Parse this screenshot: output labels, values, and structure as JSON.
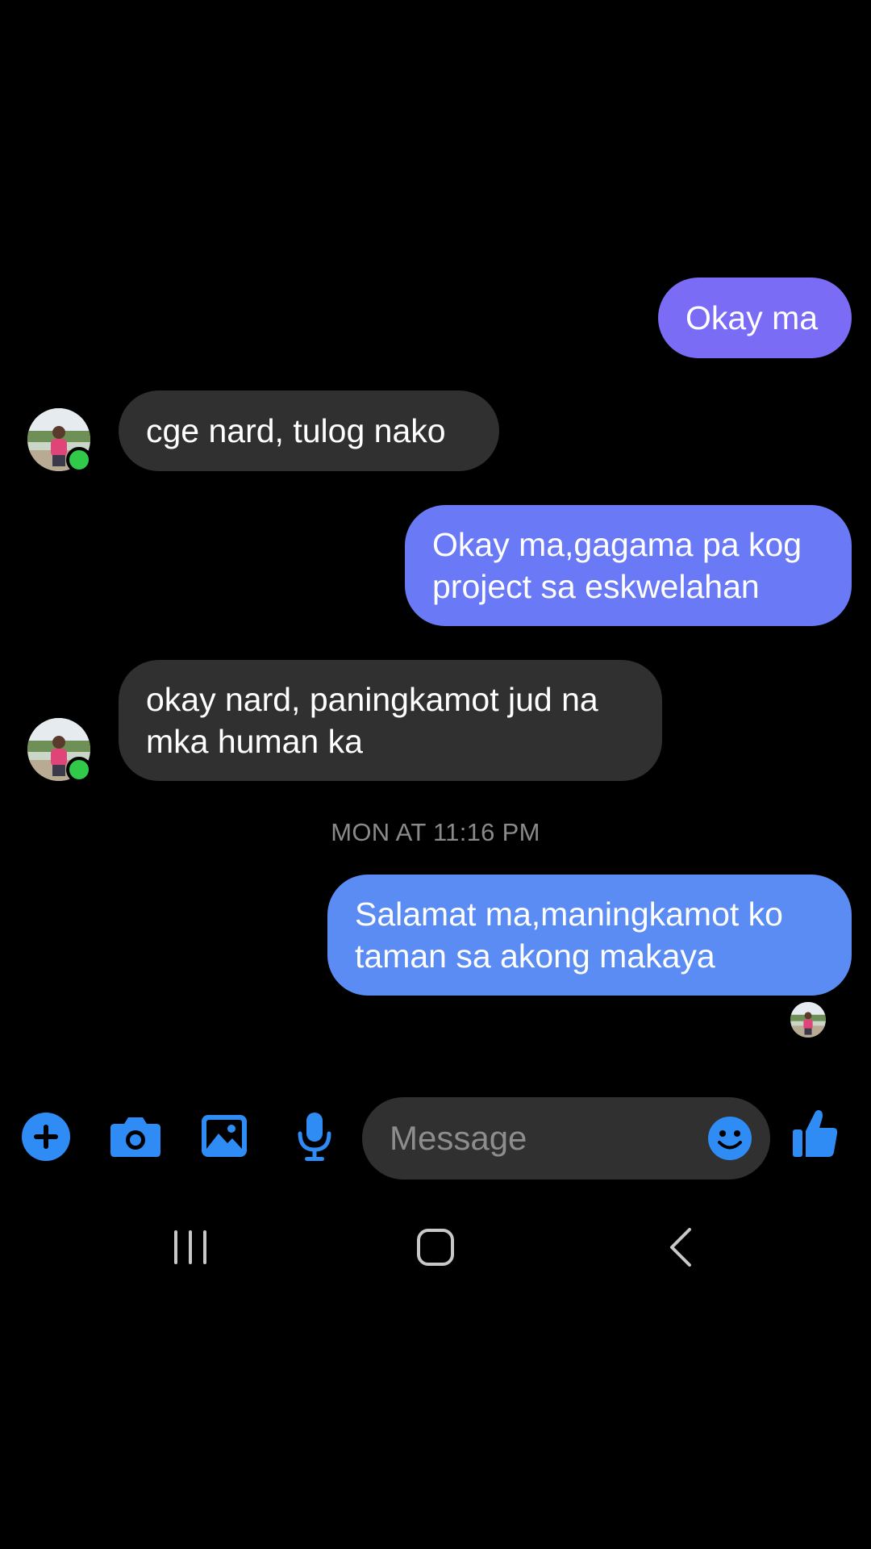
{
  "colors": {
    "background": "#000000",
    "incoming_bubble": "#303030",
    "sent_bubble_1": "#7b6cf6",
    "sent_bubble_2": "#6a7af6",
    "sent_bubble_3": "#5b8cf3",
    "accent": "#2f8cf5",
    "online": "#31c94a"
  },
  "messages": [
    {
      "direction": "sent",
      "text": "Okay ma"
    },
    {
      "direction": "received",
      "text": "cge nard, tulog nako",
      "avatar": "contact-avatar",
      "online": true
    },
    {
      "direction": "sent",
      "text": "Okay ma,gagama pa kog\nproject sa eskwelahan"
    },
    {
      "direction": "received",
      "text": "okay nard, paningkamot jud na\nmka human ka",
      "avatar": "contact-avatar",
      "online": true
    },
    {
      "direction": "sent",
      "text": "Salamat ma,maningkamot ko\ntaman sa akong makaya"
    }
  ],
  "timestamp": "MON AT 11:16 PM",
  "seen_indicator": "contact-avatar",
  "composer": {
    "icons": [
      "plus-icon",
      "camera-icon",
      "image-icon",
      "microphone-icon",
      "emoji-icon",
      "thumbs-up-icon"
    ],
    "placeholder": "Message"
  },
  "system_nav": {
    "icons": [
      "recent-apps-icon",
      "home-icon",
      "back-icon"
    ]
  }
}
